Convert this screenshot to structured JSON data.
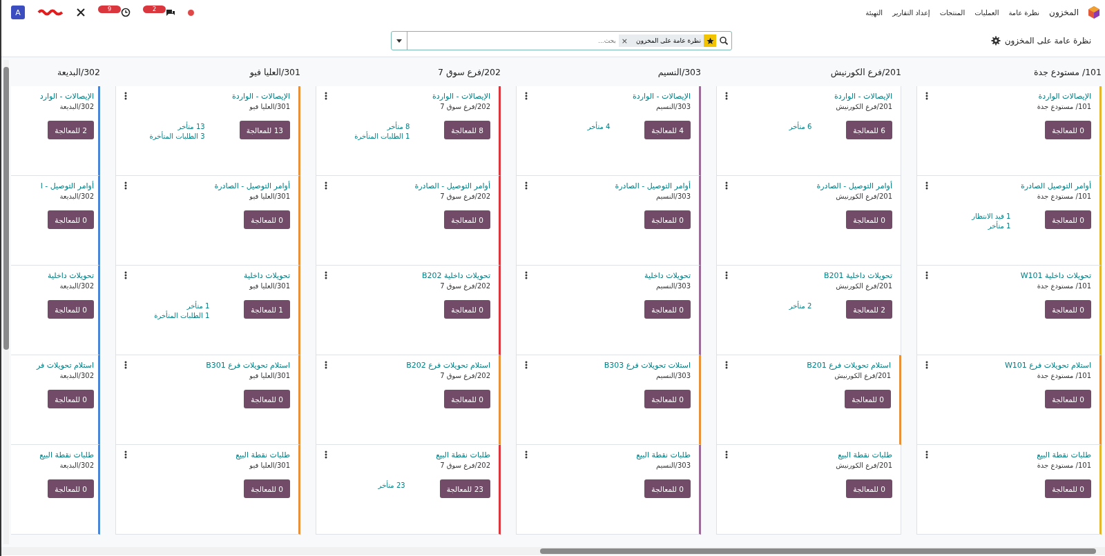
{
  "navbar": {
    "app_name": "المخزون",
    "menu": [
      {
        "label": "نظرة عامة"
      },
      {
        "label": "العمليات"
      },
      {
        "label": "المنتجات"
      },
      {
        "label": "إعداد التقارير"
      },
      {
        "label": "التهيئة"
      }
    ],
    "activity_count": "9",
    "message_count": "2",
    "avatar": "A"
  },
  "control_panel": {
    "breadcrumb": "نظرة عامة على المخزون",
    "facet": "نظرة عامة على المخزون",
    "facet_remove": "×",
    "placeholder": "بحث..."
  },
  "columns": [
    {
      "title": "101/ مستودع جدة",
      "clipped": false,
      "cards": [
        {
          "title": "الإيصالات الواردة",
          "subtitle": "101/ مستودع جدة",
          "button": "0 للمعالجة",
          "color": "#e4b62d"
        },
        {
          "title": "أوامر التوصيل الصادرة",
          "subtitle": "101/ مستودع جدة",
          "button": "0 للمعالجة",
          "stats": [
            "1 قيد الانتظار",
            "1 متأخر"
          ],
          "color": "#e4b62d"
        },
        {
          "title": "تحويلات داخلية W101",
          "subtitle": "101/ مستودع جدة",
          "button": "0 للمعالجة",
          "color": "#e4b62d"
        },
        {
          "title": "استلام تحويلات فرع W101",
          "subtitle": "101/ مستودع جدة",
          "button": "0 للمعالجة",
          "color": "#e8913b"
        },
        {
          "title": "طلبات نقطة البيع",
          "subtitle": "101/ مستودع جدة",
          "button": "0 للمعالجة",
          "color": "#e4b62d"
        }
      ]
    },
    {
      "title": "201/فرع الكورنيش",
      "clipped": false,
      "cards": [
        {
          "title": "الإيصالات - الواردة",
          "subtitle": "201/فرع الكورنيش",
          "button": "6 للمعالجة",
          "stats": [
            "6 متأخر"
          ]
        },
        {
          "title": "أوامر التوصيل - الصادرة",
          "subtitle": "201/فرع الكورنيش",
          "button": "0 للمعالجة"
        },
        {
          "title": "تحويلات داخلية B201",
          "subtitle": "201/فرع الكورنيش",
          "button": "2 للمعالجة",
          "stats": [
            "2 متأخر"
          ]
        },
        {
          "title": "استلام تحويلات فرع B201",
          "subtitle": "201/فرع الكورنيش",
          "button": "0 للمعالجة",
          "color": "#e8913b"
        },
        {
          "title": "طلبات نقطة البيع",
          "subtitle": "201/فرع الكورنيش",
          "button": "0 للمعالجة"
        }
      ]
    },
    {
      "title": "303/النسيم",
      "clipped": false,
      "cards": [
        {
          "title": "الإيصالات - الواردة",
          "subtitle": "303/النسيم",
          "button": "4 للمعالجة",
          "stats": [
            "4 متأخر"
          ],
          "color": "#9b6b98"
        },
        {
          "title": "أوامر التوصيل - الصادرة",
          "subtitle": "303/النسيم",
          "button": "0 للمعالجة",
          "color": "#9b6b98"
        },
        {
          "title": "تحويلات داخلية",
          "subtitle": "303/النسيم",
          "button": "0 للمعالجة",
          "color": "#9b6b98"
        },
        {
          "title": "استلات تحويلات فرع B303",
          "subtitle": "303/النسيم",
          "button": "0 للمعالجة",
          "color": "#e8913b"
        },
        {
          "title": "طلبات نقطة البيع",
          "subtitle": "303/النسيم",
          "button": "0 للمعالجة",
          "color": "#9b6b98"
        }
      ]
    },
    {
      "title": "202/فرع سوق 7",
      "clipped": false,
      "cards": [
        {
          "title": "الإيصالات - الواردة",
          "subtitle": "202/فرع سوق 7",
          "button": "8 للمعالجة",
          "stats": [
            "8 متأخر",
            "1 الطلبات المتأخرة"
          ],
          "color": "#d9363e"
        },
        {
          "title": "أوامر التوصيل - الصادرة",
          "subtitle": "202/فرع سوق 7",
          "button": "0 للمعالجة",
          "color": "#d9363e"
        },
        {
          "title": "تحويلات داخلية B202",
          "subtitle": "202/فرع سوق 7",
          "button": "0 للمعالجة",
          "color": "#d9363e"
        },
        {
          "title": "استلام تحويلات فرع B202",
          "subtitle": "202/فرع سوق 7",
          "button": "0 للمعالجة",
          "color": "#e8913b"
        },
        {
          "title": "طلبات نقطة البيع",
          "subtitle": "202/فرع سوق 7",
          "button": "23 للمعالجة",
          "stats": [
            "23 متأخر"
          ],
          "color": "#d9363e"
        }
      ]
    },
    {
      "title": "301/العليا فيو",
      "clipped": false,
      "cards": [
        {
          "title": "الإيصالات - الواردة",
          "subtitle": "301/العليا فيو",
          "button": "13 للمعالجة",
          "stats": [
            "13 متأخر",
            "3 الطلبات المتأخرة"
          ],
          "color": "#e8913b"
        },
        {
          "title": "أوامر التوصيل - الصادرة",
          "subtitle": "301/العليا فيو",
          "button": "0 للمعالجة",
          "color": "#e8913b"
        },
        {
          "title": "تحويلات داخلية",
          "subtitle": "301/العليا فيو",
          "button": "1 للمعالجة",
          "stats": [
            "1 متأخر",
            "1 الطلبات المتأخرة"
          ],
          "color": "#e8913b"
        },
        {
          "title": "استلام تحويلات فرع B301",
          "subtitle": "301/العليا فيو",
          "button": "0 للمعالجة",
          "color": "#e8913b"
        },
        {
          "title": "طلبات نقطة البيع",
          "subtitle": "301/العليا فيو",
          "button": "0 للمعالجة",
          "color": "#e8913b"
        }
      ]
    },
    {
      "title": "302/البديعة",
      "clipped": true,
      "cards": [
        {
          "title": "الإيصالات - الوارد",
          "subtitle": "302/البديعة",
          "button": "2 للمعالجة",
          "color": "#4a86d4"
        },
        {
          "title": "أوامر التوصيل - ا",
          "subtitle": "302/البديعة",
          "button": "0 للمعالجة",
          "color": "#4a86d4"
        },
        {
          "title": "تحويلات داخلية",
          "subtitle": "302/البديعة",
          "button": "0 للمعالجة",
          "color": "#4a86d4"
        },
        {
          "title": "استلام تحويلات فر",
          "subtitle": "302/البديعة",
          "button": "0 للمعالجة",
          "color": "#4a86d4"
        },
        {
          "title": "طلبات نقطة البيع",
          "subtitle": "302/البديعة",
          "button": "0 للمعالجة",
          "color": "#4a86d4"
        }
      ]
    }
  ]
}
